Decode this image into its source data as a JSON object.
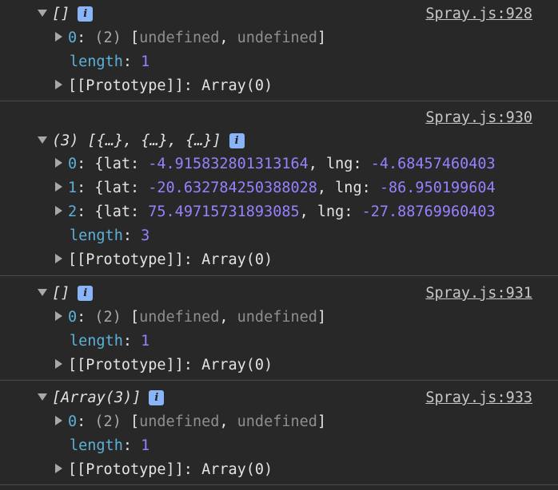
{
  "entries": [
    {
      "summary": "[]",
      "source": "Spray.js:928",
      "rows": [
        {
          "key": "0",
          "count": "(2)",
          "open": "[",
          "v1": "undefined",
          "sep": ", ",
          "v2": "undefined",
          "close": "]"
        },
        {
          "key": "length",
          "value": "1"
        },
        {
          "proto": "[[Prototype]]",
          "proto_value": "Array(0)"
        }
      ]
    },
    {
      "summary": "(3) [{…}, {…}, {…}]",
      "source": "Spray.js:930",
      "rows": [
        {
          "key": "0",
          "lat_label": "lat",
          "lat": "-4.915832801313164",
          "lng_label": "lng",
          "lng": "-4.68457460403"
        },
        {
          "key": "1",
          "lat_label": "lat",
          "lat": "-20.632784250388028",
          "lng_label": "lng",
          "lng": "-86.950199604"
        },
        {
          "key": "2",
          "lat_label": "lat",
          "lat": "75.49715731893085",
          "lng_label": "lng",
          "lng": "-27.88769960403"
        },
        {
          "key": "length",
          "value": "3"
        },
        {
          "proto": "[[Prototype]]",
          "proto_value": "Array(0)"
        }
      ]
    },
    {
      "summary": "[]",
      "source": "Spray.js:931",
      "rows": [
        {
          "key": "0",
          "count": "(2)",
          "open": "[",
          "v1": "undefined",
          "sep": ", ",
          "v2": "undefined",
          "close": "]"
        },
        {
          "key": "length",
          "value": "1"
        },
        {
          "proto": "[[Prototype]]",
          "proto_value": "Array(0)"
        }
      ]
    },
    {
      "summary": "[Array(3)]",
      "source": "Spray.js:933",
      "rows": [
        {
          "key": "0",
          "count": "(2)",
          "open": "[",
          "v1": "undefined",
          "sep": ", ",
          "v2": "undefined",
          "close": "]"
        },
        {
          "key": "length",
          "value": "1"
        },
        {
          "proto": "[[Prototype]]",
          "proto_value": "Array(0)"
        }
      ]
    }
  ],
  "info_glyph": "i",
  "icons": {
    "expanded": "triangle-down-icon",
    "collapsed": "triangle-right-icon",
    "info": "info-icon"
  },
  "colors": {
    "background": "#282828",
    "key": "#5db0d7",
    "number": "#9980ff",
    "undefined": "#8f8f8f",
    "info_badge": "#8ab4f8"
  }
}
